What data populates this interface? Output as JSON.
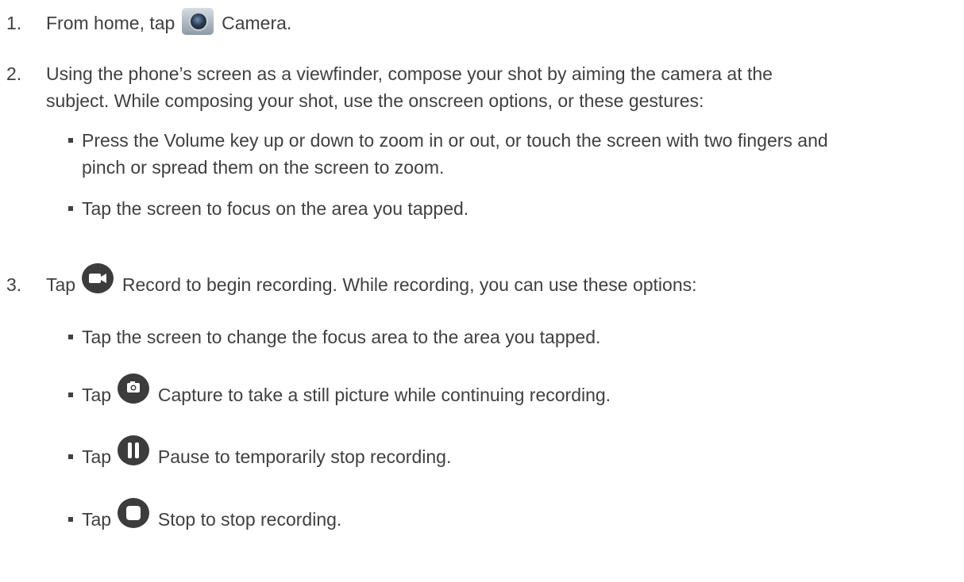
{
  "steps": [
    {
      "number": "1.",
      "before": "From home, tap",
      "icon": "camera-app-icon",
      "after": "Camera."
    },
    {
      "number": "2.",
      "line1": "Using the phone’s screen as a viewfinder, compose your shot by aiming the camera at the",
      "line2": "subject. While composing your shot, use the onscreen options, or these gestures:",
      "bullets": [
        {
          "line1": "Press the Volume  key up or down to zoom in or out, or touch the screen with two fingers and",
          "line2": "pinch or spread them on the screen to zoom."
        },
        {
          "line1": "Tap the screen to focus on the area you tapped."
        }
      ]
    },
    {
      "number": "3.",
      "before": "Tap",
      "icon": "record-icon",
      "after": "Record  to begin recording. While recording, you can use these options:",
      "bullets": [
        {
          "text": "Tap the screen to change the focus area to the area you tapped."
        },
        {
          "before": "Tap",
          "icon": "capture-icon",
          "after": "Capture  to take a still picture while continuing recording."
        },
        {
          "before": "Tap",
          "icon": "pause-icon",
          "after": "Pause  to temporarily stop recording."
        },
        {
          "before": "Tap",
          "icon": "stop-icon",
          "after": "Stop  to stop recording."
        }
      ]
    }
  ],
  "colors": {
    "text": "#404040",
    "icon": "#3c3c3c"
  }
}
